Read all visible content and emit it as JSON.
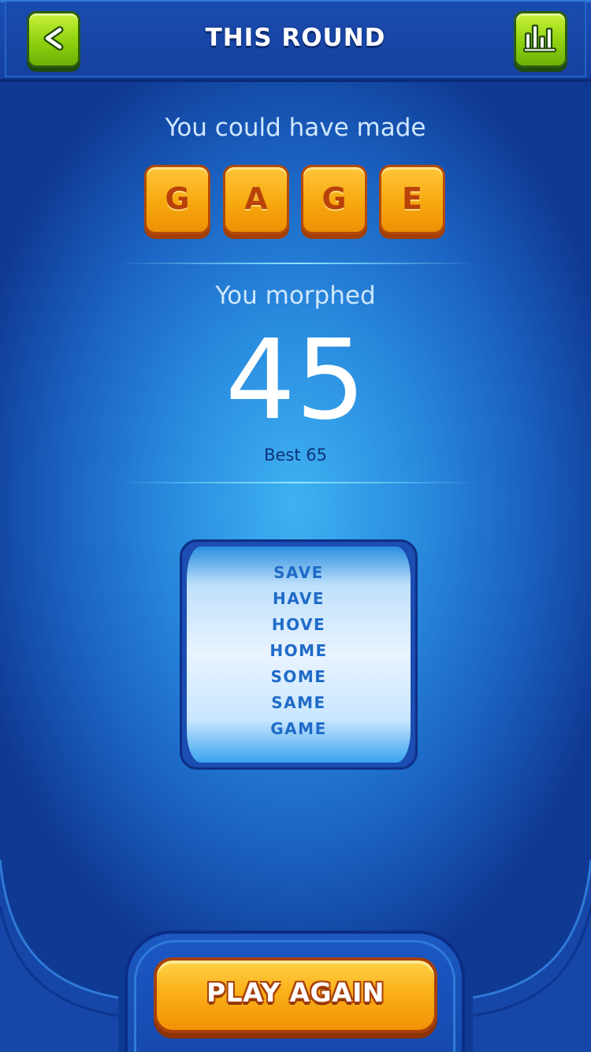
{
  "header": {
    "title": "THIS ROUND",
    "back_icon": "chevron-left-icon",
    "stats_icon": "bar-chart-icon",
    "accent_color": "#8fd10e"
  },
  "result": {
    "could_have_made_label": "You could have made",
    "tiles": [
      "G",
      "A",
      "G",
      "E"
    ],
    "tile_color": "#f7a90e",
    "morphed_label": "You morphed",
    "score": "45",
    "best_label": "Best 65"
  },
  "words": [
    "SAVE",
    "HAVE",
    "HOVE",
    "HOME",
    "SOME",
    "SAME",
    "GAME"
  ],
  "footer": {
    "play_again_label": "PLAY AGAIN",
    "button_color": "#fbb019"
  }
}
